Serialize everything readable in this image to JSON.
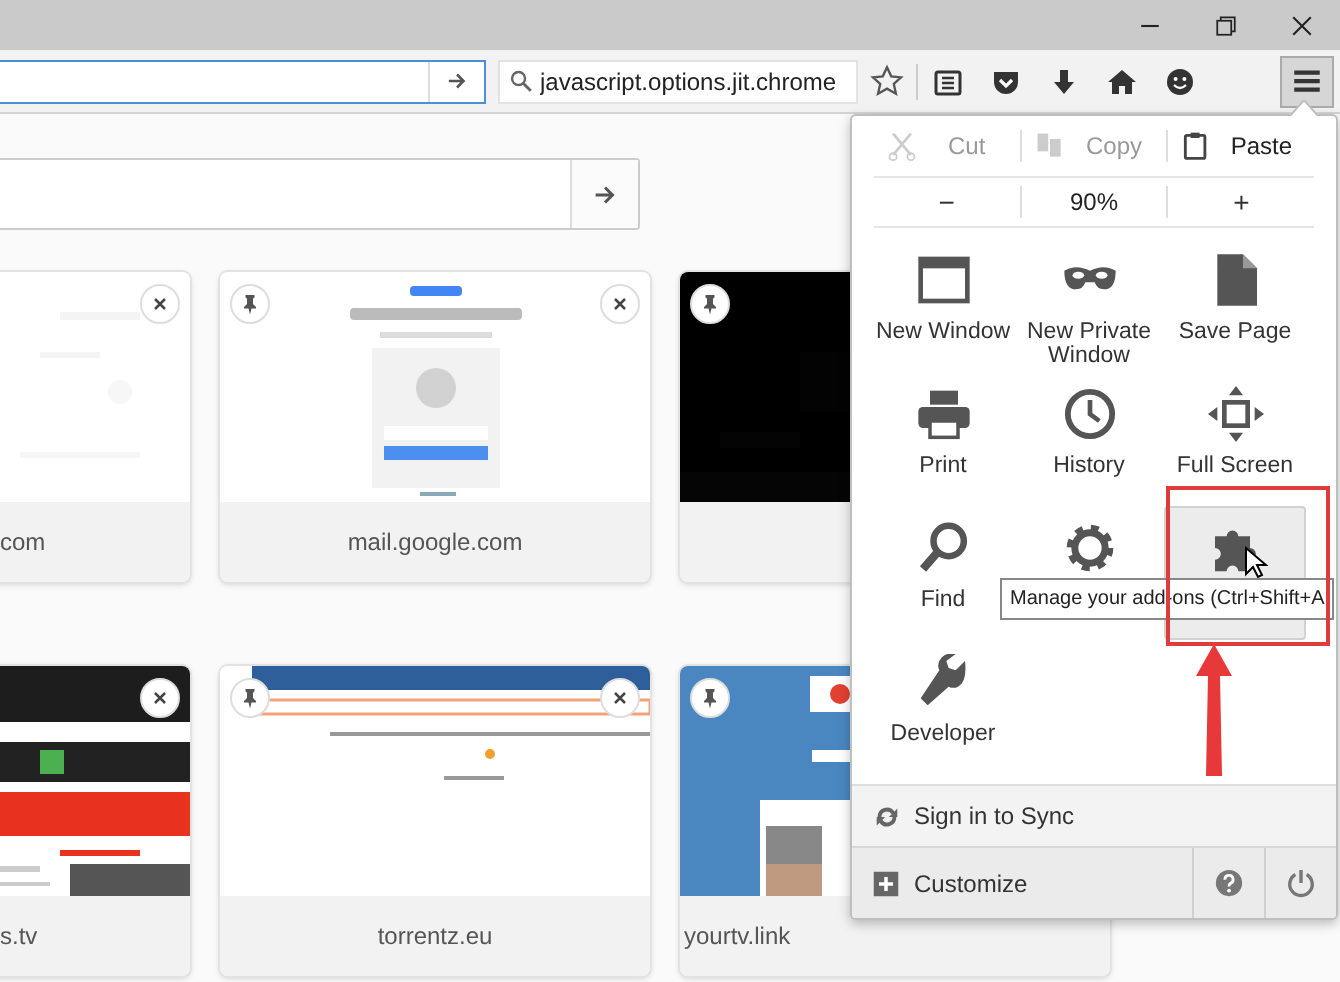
{
  "url_bar": {
    "focused": true
  },
  "search_bar": {
    "value": "javascript.options.jit.chrome"
  },
  "menu_button": {
    "open": true
  },
  "tiles": [
    {
      "label": "com",
      "kind": "blank"
    },
    {
      "label": "mail.google.com",
      "kind": "login"
    },
    {
      "kind": "black"
    },
    {
      "label": "s.tv",
      "kind": "dark"
    },
    {
      "label": "torrentz.eu",
      "kind": "torrent"
    },
    {
      "label": "yourtv.link",
      "kind": "blue"
    }
  ],
  "menu": {
    "edit": [
      {
        "label": "Cut",
        "kind": "cut",
        "disabled": true
      },
      {
        "label": "Copy",
        "kind": "copy",
        "disabled": true
      },
      {
        "label": "Paste",
        "kind": "paste",
        "disabled": false
      }
    ],
    "zoom": {
      "out": "−",
      "reading": "90%",
      "in": "+"
    },
    "items": [
      {
        "label": "New Window",
        "kind": "window",
        "hovered": false
      },
      {
        "label": "New Private Window",
        "kind": "mask",
        "hovered": false
      },
      {
        "label": "Save Page",
        "kind": "page",
        "hovered": false
      },
      {
        "label": "Print",
        "kind": "printer",
        "hovered": false
      },
      {
        "label": "History",
        "kind": "clock",
        "hovered": false
      },
      {
        "label": "Full Screen",
        "kind": "fullscreen",
        "hovered": false
      },
      {
        "label": "Find",
        "kind": "magnifier",
        "hovered": false
      },
      {
        "kind": "gear",
        "hovered": false
      },
      {
        "kind": "puzzle",
        "hovered": true
      },
      {
        "label": "Developer",
        "kind": "wrench",
        "hovered": false
      }
    ],
    "sync": "Sign in to Sync",
    "customize": "Customize",
    "tooltip": "Manage your add-ons (Ctrl+Shift+A"
  }
}
